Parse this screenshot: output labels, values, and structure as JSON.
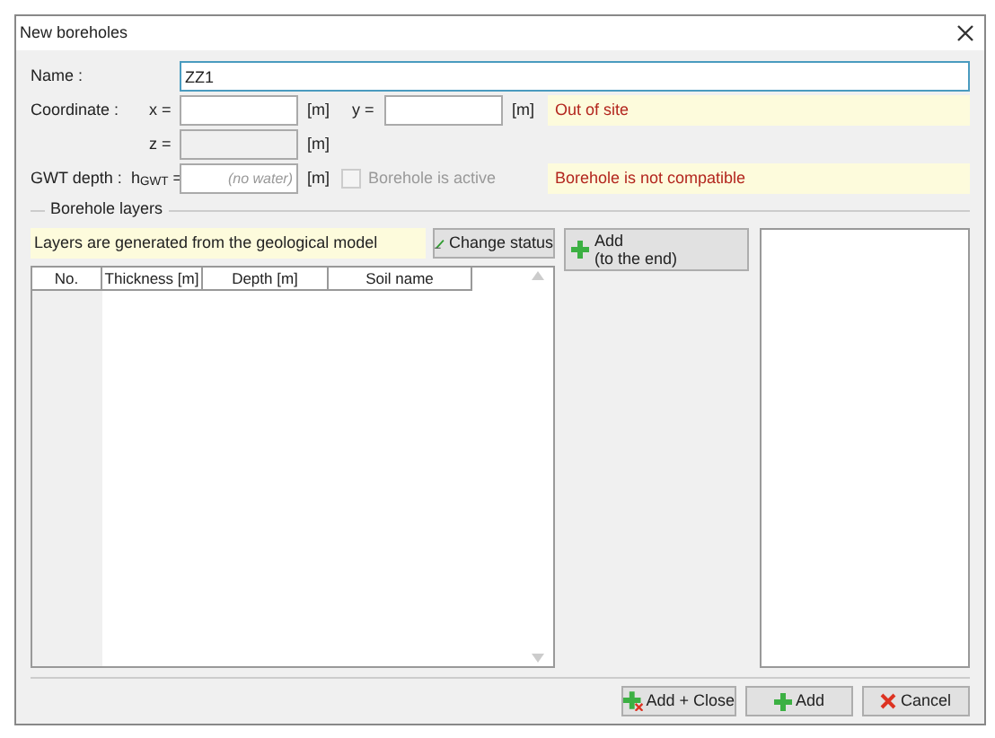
{
  "window": {
    "title": "New boreholes"
  },
  "name": {
    "label": "Name :",
    "value": "ZZ1"
  },
  "coordinate": {
    "label": "Coordinate :",
    "x_label": "x =",
    "x_unit": "[m]",
    "y_label": "y =",
    "y_unit": "[m]",
    "z_label": "z =",
    "z_unit": "[m]",
    "z_disabled": true,
    "message": "Out of site"
  },
  "gwt": {
    "label": "GWT depth :",
    "symbol": "h$_{GWT}$ =",
    "placeholder": "(no water)",
    "unit": "[m]",
    "active_label": "Borehole is active",
    "active_checked": false,
    "active_disabled": true,
    "message": "Borehole is not compatible"
  },
  "layers": {
    "title": "Borehole layers",
    "note": "Layers are generated from the geological model",
    "change_button": "Change status",
    "add_end_button": [
      "Add",
      "(to the end)"
    ],
    "columns": [
      "No.",
      "Thickness [m]",
      "Depth [m]",
      "Soil name"
    ]
  },
  "buttons": [
    {
      "kind": "add_close",
      "label": "Add + Close"
    },
    {
      "kind": "add",
      "label": "Add"
    },
    {
      "kind": "cancel",
      "label": "Cancel"
    }
  ]
}
